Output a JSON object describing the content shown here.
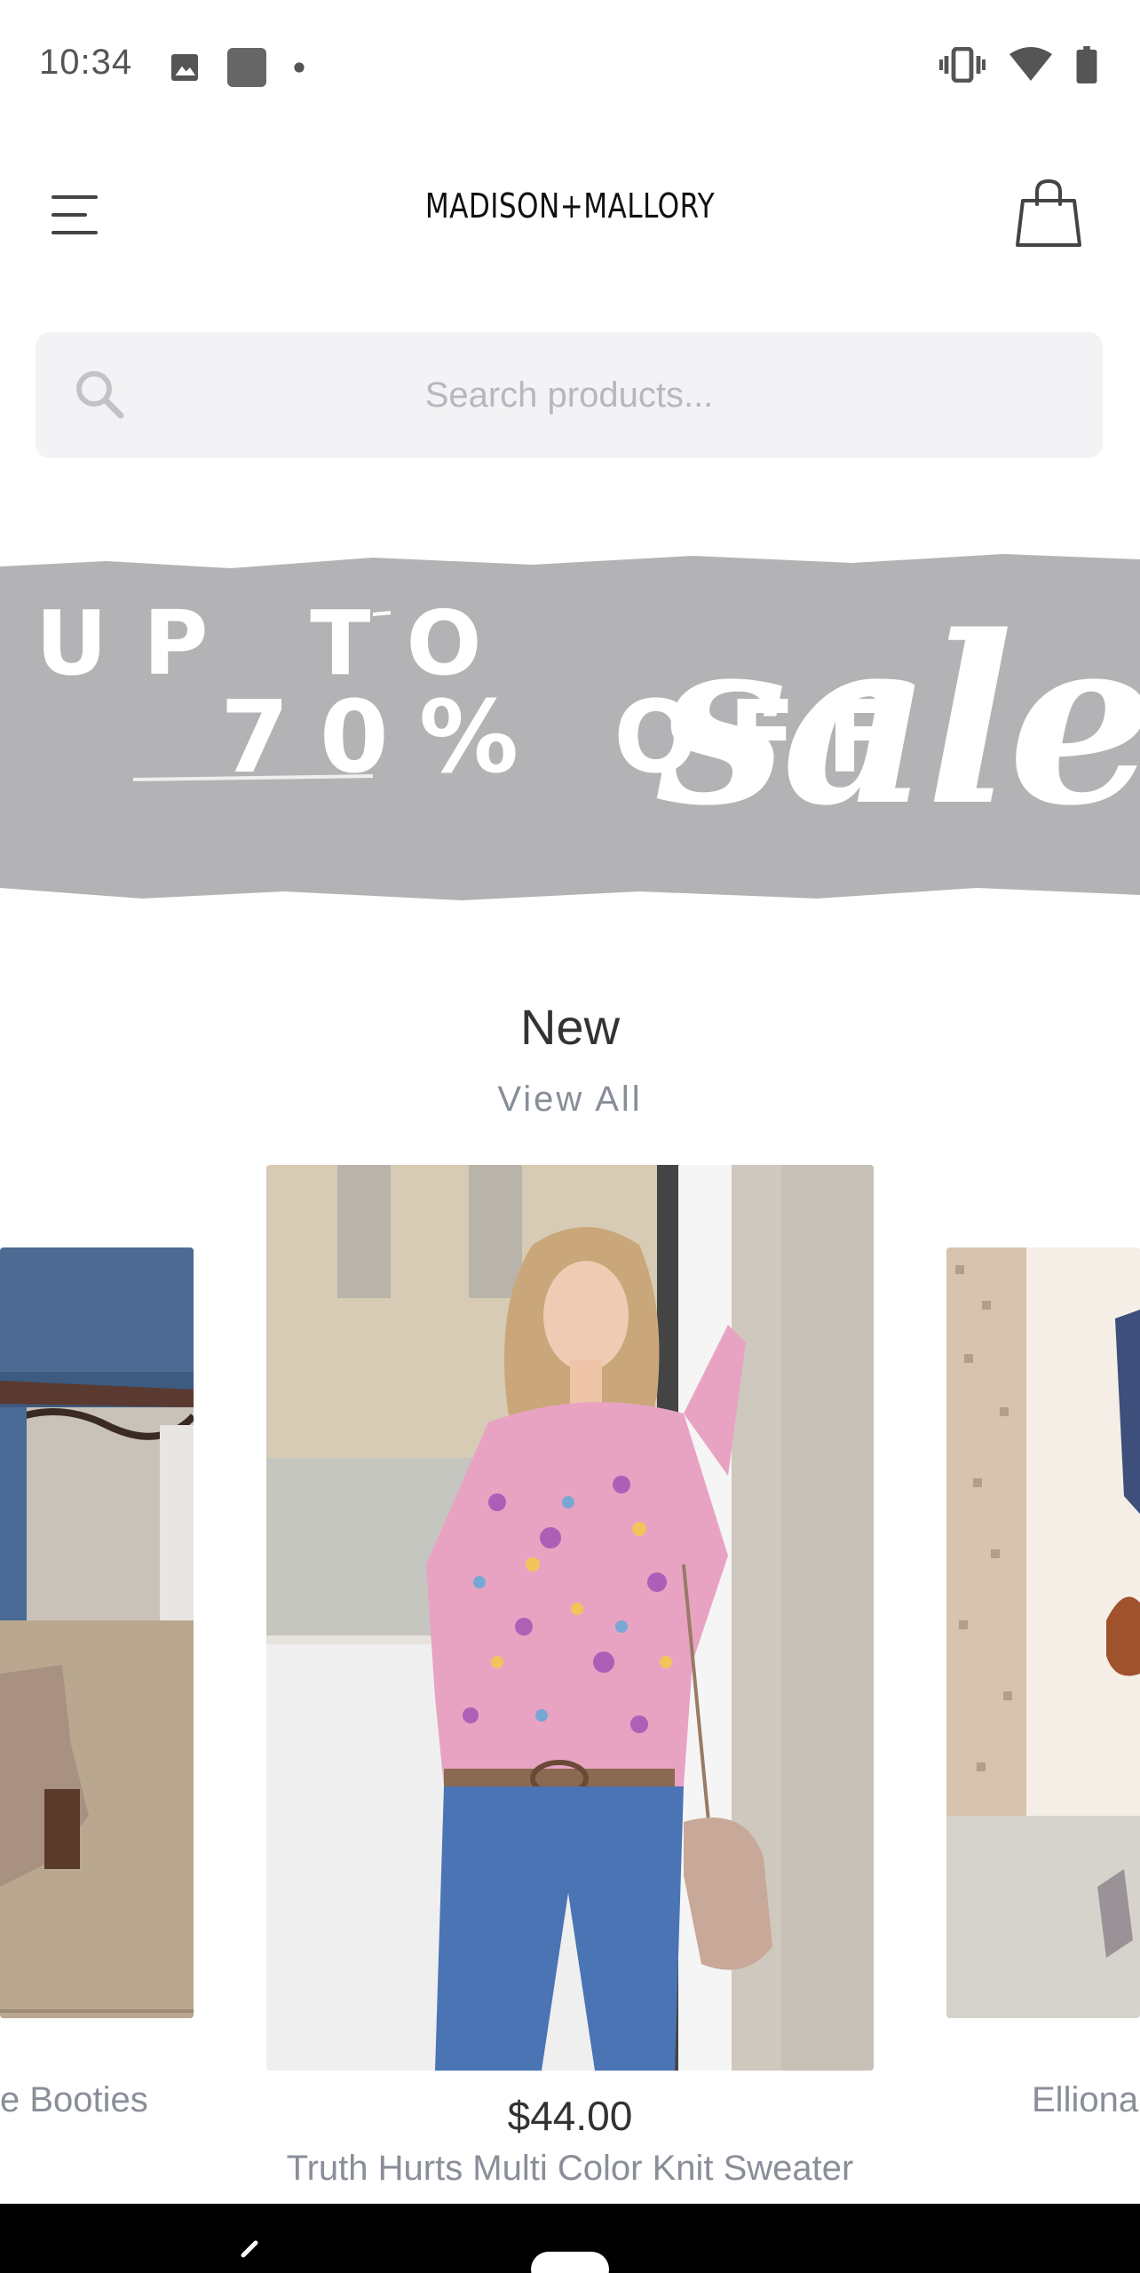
{
  "status_bar": {
    "time": "10:34",
    "left_icons": [
      "image-icon",
      "app-icon",
      "dot-icon"
    ],
    "right_icons": [
      "vibrate-icon",
      "wifi-icon",
      "battery-icon"
    ]
  },
  "header": {
    "brand": "MADISON+MALLORY",
    "menu_icon": "hamburger-icon",
    "cart_icon": "shopping-bag-icon"
  },
  "search": {
    "placeholder": "Search products..."
  },
  "banner": {
    "line1": "UP TO",
    "line2": "70% OFF",
    "script": "sale",
    "background_color": "#b3b2b5"
  },
  "section": {
    "title": "New",
    "view_all": "View All"
  },
  "products": [
    {
      "name": "e Booties"
    },
    {
      "price": "$44.00",
      "name": "Truth Hurts Multi Color Knit Sweater"
    },
    {
      "name": "Elliona Fl"
    }
  ]
}
